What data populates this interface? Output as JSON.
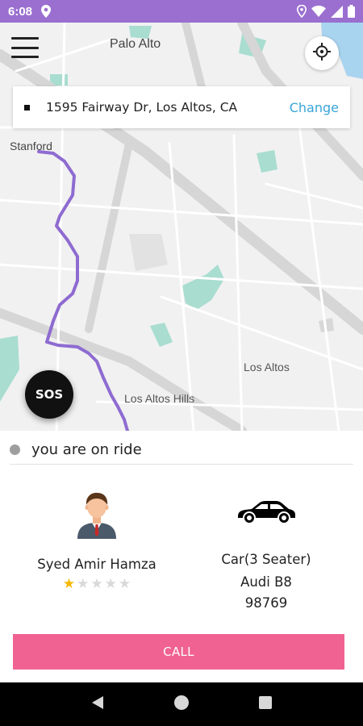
{
  "status_bar": {
    "time": "6:08",
    "background_color": "#9a6fd0",
    "icons": [
      "location-pin-icon",
      "location-icon",
      "wifi-icon",
      "signal-icon",
      "battery-icon"
    ]
  },
  "map": {
    "labels": {
      "palo_alto": "Palo Alto",
      "stanford": "Stanford",
      "los_altos": "Los Altos",
      "los_altos_hills": "Los Altos Hills"
    },
    "route_color": "#8e6bd1",
    "park_color": "#a8ddd0"
  },
  "header": {
    "menu_icon": "hamburger-menu-icon",
    "locate_icon": "crosshair-icon"
  },
  "address": {
    "text": "1595 Fairway Dr, Los Altos, CA",
    "change_label": "Change",
    "accent_color": "#3aa6d8"
  },
  "sos": {
    "label": "SOS"
  },
  "ride_status": {
    "text": "you are on ride"
  },
  "driver": {
    "name": "Syed Amir Hamza",
    "rating": 1,
    "max_rating": 5,
    "avatar_icon": "driver-avatar-icon"
  },
  "car": {
    "type": "Car(3 Seater)",
    "model": "Audi B8",
    "plate": "98769",
    "icon": "car-icon"
  },
  "call": {
    "label": "CALL",
    "color": "#f06292"
  },
  "nav_bar": {
    "icons": [
      "back-icon",
      "home-icon",
      "recents-icon"
    ]
  }
}
